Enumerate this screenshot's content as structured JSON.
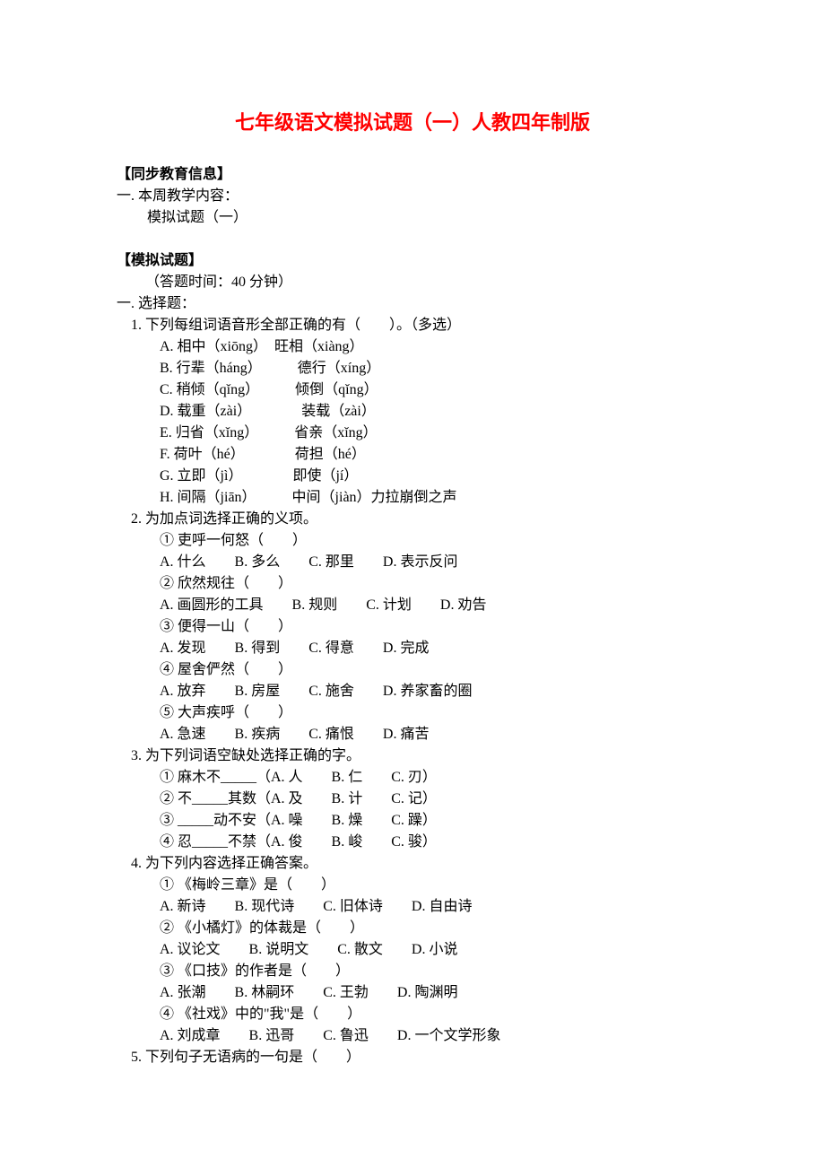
{
  "title": "七年级语文模拟试题（一）人教四年制版",
  "section1_hdr": "【同步教育信息】",
  "weekly_prefix": "一. 本周教学内容：",
  "weekly_content": "模拟试题（一）",
  "section2_hdr": "【模拟试题】",
  "time_note": "（答题时间：40 分钟）",
  "part1_hdr": "一. 选择题：",
  "q1": {
    "stem": "1. 下列每组词语音形全部正确的有（　　）。（多选）",
    "A": "A. 相中（xiōng）　旺相（xiàng）",
    "B": "B. 行辈（háng）　　　德行（xíng）",
    "C": "C. 稍倾（qǐng）　　　倾倒（qǐng）",
    "D": "D. 载重（zài）　　　　装载（zài）",
    "E": "E. 归省（xǐng）　　　省亲（xǐng）",
    "F": "F. 荷叶（hé）　　　　荷担（hé）",
    "G": "G. 立即（jì）　　　　即使（jí）",
    "H": "H. 间隔（jiān）　　　中间（jiàn）力拉崩倒之声"
  },
  "q2": {
    "stem": "2. 为加点词选择正确的义项。",
    "s1": "① 吏呼一何怒（　　）",
    "s1o": "A. 什么　　B. 多么　　C. 那里　　D. 表示反问",
    "s2": "② 欣然规往（　　）",
    "s2o": "A. 画圆形的工具　　B. 规则　　C. 计划　　D. 劝告",
    "s3": "③ 便得一山（　　）",
    "s3o": "A. 发现　　B. 得到　　C. 得意　　D. 完成",
    "s4": "④ 屋舍俨然（　　）",
    "s4o": "A. 放弃　　B. 房屋　　C. 施舍　　D. 养家畜的圈",
    "s5": "⑤ 大声疾呼（　　）",
    "s5o": "A. 急速　　B. 疾病　　C. 痛恨　　D. 痛苦"
  },
  "q3": {
    "stem": "3. 为下列词语空缺处选择正确的字。",
    "s1": "① 麻木不_____（A. 人　　B. 仁　　C. 刃）",
    "s2": "② 不_____其数（A. 及　　B. 计　　C. 记）",
    "s3": "③ _____动不安（A. 噪　　B. 燥　　C. 躁）",
    "s4": "④ 忍_____不禁（A. 俊　　B. 峻　　C. 骏）"
  },
  "q4": {
    "stem": "4. 为下列内容选择正确答案。",
    "s1": "① 《梅岭三章》是（　　）",
    "s1o": "A. 新诗　　B. 现代诗　　C. 旧体诗　　D. 自由诗",
    "s2": "② 《小橘灯》的体裁是（　　）",
    "s2o": "A. 议论文　　B. 说明文　　C. 散文　　D. 小说",
    "s3": "③ 《口技》的作者是（　　）",
    "s3o": "A. 张潮　　B. 林嗣环　　C. 王勃　　D. 陶渊明",
    "s4": "④ 《社戏》中的\"我\"是（　　）",
    "s4o": "A. 刘成章　　B. 迅哥　　C. 鲁迅　　D. 一个文学形象"
  },
  "q5": {
    "stem": "5. 下列句子无语病的一句是（　　）"
  }
}
